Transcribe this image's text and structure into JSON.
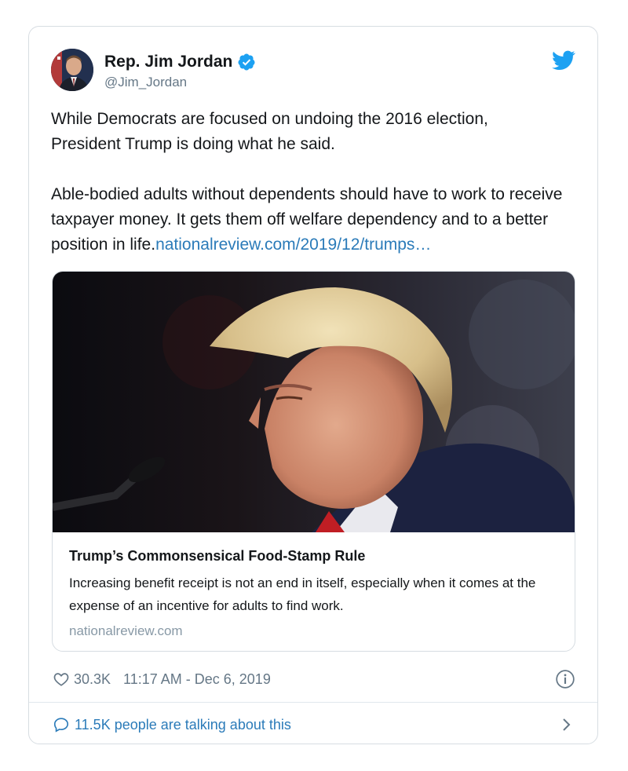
{
  "tweet": {
    "author": {
      "display_name": "Rep. Jim Jordan",
      "handle": "@Jim_Jordan",
      "verified": true
    },
    "text_line1": "While Democrats are focused on undoing the 2016 election,",
    "text_line2": "President Trump is doing what he said.",
    "text_para2": "Able-bodied adults without dependents should have to work to receive taxpayer money. It gets them off welfare dependency and to a better position in life.",
    "link_text": "nationalreview.com/2019/12/trumps…",
    "card": {
      "title": "Trump’s Commonsensical Food-Stamp Rule",
      "description": "Increasing benefit receipt is not an end in itself, especially when it comes at the expense of an incentive for adults to find work.",
      "domain": "nationalreview.com"
    },
    "likes": "30.3K",
    "timestamp": "11:17 AM - Dec 6, 2019",
    "conversation_text": "11.5K people are talking about this"
  },
  "colors": {
    "link": "#2b7bb9",
    "twitter_blue": "#1da1f2",
    "secondary_text": "#657786"
  },
  "icons": [
    "verified-badge-icon",
    "twitter-bird-icon",
    "heart-icon",
    "info-icon",
    "comment-icon",
    "chevron-right-icon"
  ]
}
